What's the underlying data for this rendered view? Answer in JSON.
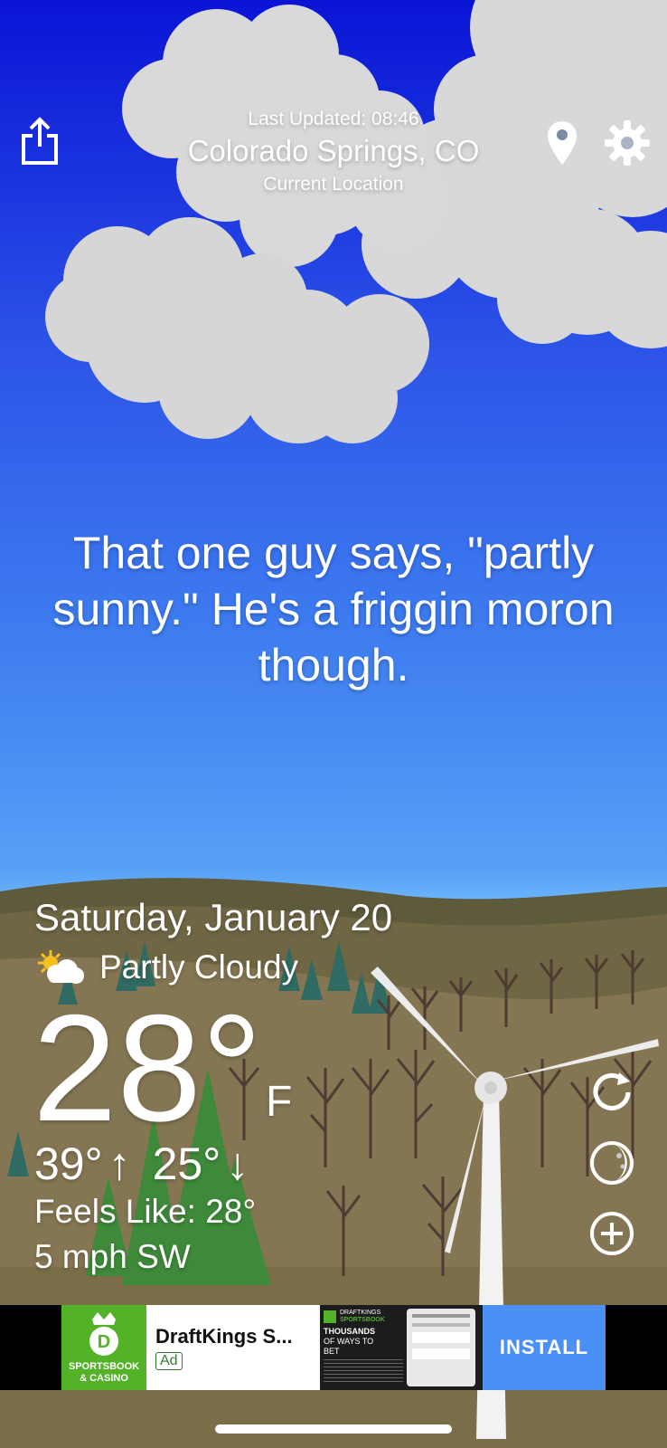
{
  "header": {
    "last_updated": "Last Updated: 08:46",
    "location": "Colorado Springs, CO",
    "location_sub": "Current Location",
    "share_icon": "share-icon",
    "pin_icon": "location-pin-icon",
    "settings_icon": "gear-icon"
  },
  "quote": {
    "line1": "That one guy says, \"partly",
    "line2": "sunny.\" He's a friggin moron",
    "line3": "though."
  },
  "weather": {
    "date": "Saturday, January 20",
    "condition": "Partly Cloudy",
    "condition_icon": "partly-cloudy-icon",
    "temp": "28°",
    "unit": "F",
    "high": "39°",
    "high_arrow": "↑",
    "low": "25°",
    "low_arrow": "↓",
    "feels_like": "Feels Like: 28°",
    "wind": "5 mph SW"
  },
  "side_buttons": {
    "refresh_icon": "refresh-icon",
    "moon_icon": "moon-icon",
    "add_icon": "add-icon"
  },
  "ad": {
    "logo_line1": "SPORTSBOOK",
    "logo_line2": "& CASINO",
    "title": "DraftKings S...",
    "badge": "Ad",
    "shot_brand": "DRAFTKINGS",
    "shot_brand2": "SPORTSBOOK",
    "shot_line1": "THOUSANDS",
    "shot_line2": "OF WAYS TO",
    "shot_line3": "BET",
    "install": "INSTALL"
  },
  "colors": {
    "sky_top": "#0a14d6",
    "sky_bottom": "#6ab2fa",
    "ground": "#7b6d48",
    "ad_green": "#53b228",
    "install_blue": "#4b90f5"
  }
}
